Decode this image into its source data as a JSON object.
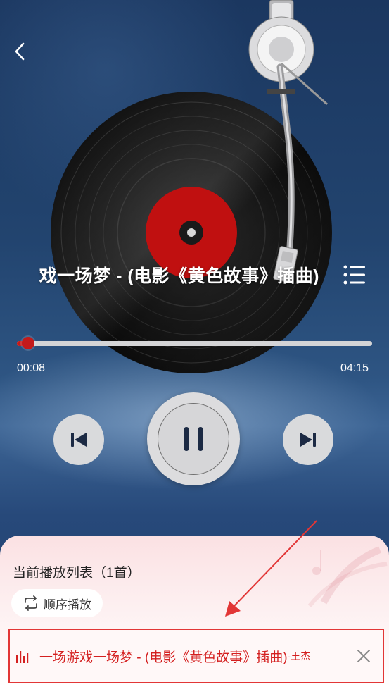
{
  "player": {
    "song_title": "戏一场梦 - (电影《黄色故事》插曲)",
    "current_time": "00:08",
    "total_time": "04:15",
    "progress": 0.031
  },
  "playlist": {
    "header": "当前播放列表（1首）",
    "order_mode": "顺序播放",
    "current_song": "一场游戏一场梦 - (电影《黄色故事》插曲)",
    "current_artist": "-王杰"
  },
  "icons": {
    "back": "chevron-left-icon",
    "playlist": "list-icon",
    "prev": "skip-previous-icon",
    "pause": "pause-icon",
    "next": "skip-next-icon",
    "order": "repeat-icon",
    "playing": "equalizer-icon",
    "remove": "close-icon"
  },
  "colors": {
    "accent": "#d42020",
    "background": "#1f3f6c",
    "label": "#c01010"
  }
}
